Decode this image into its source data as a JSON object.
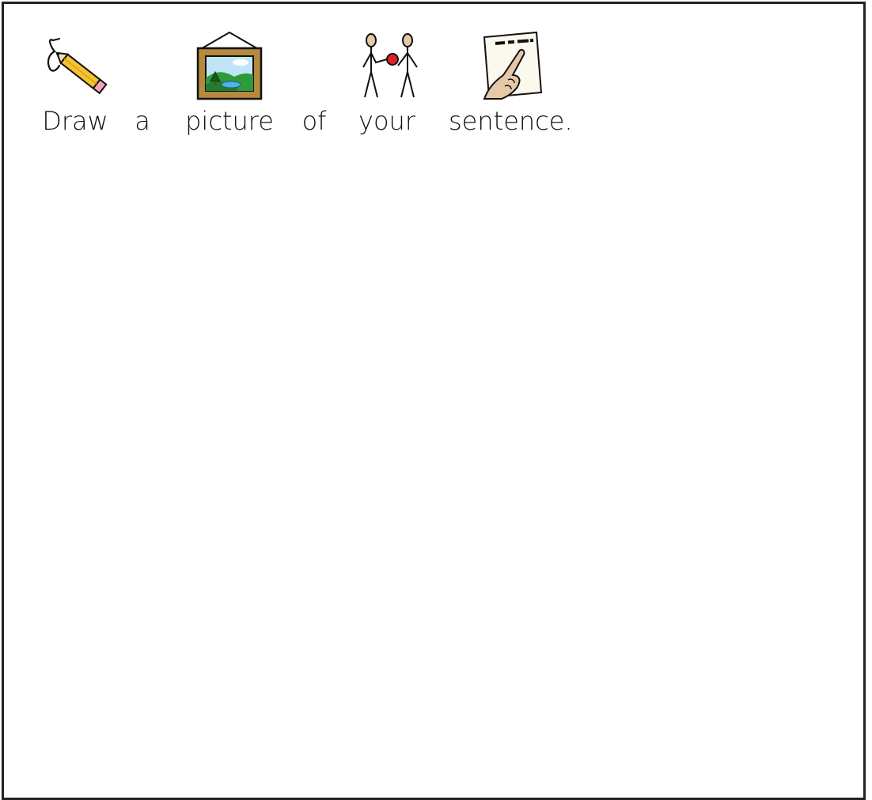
{
  "worksheet": {
    "instruction_words": [
      {
        "text": "Draw",
        "symbol": "pencil-writing-icon"
      },
      {
        "text": "a",
        "symbol": ""
      },
      {
        "text": "picture",
        "symbol": "framed-picture-icon"
      },
      {
        "text": "of",
        "symbol": ""
      },
      {
        "text": "your",
        "symbol": "two-people-your-icon"
      },
      {
        "text": "sentence.",
        "symbol": "pointing-at-text-icon"
      }
    ]
  },
  "colors": {
    "border": "#222222",
    "pencil": "#f2c230",
    "frame": "#b58a3c",
    "grass": "#2e9b3a",
    "sky": "#bfe6f6",
    "ball": "#e0202a",
    "skin": "#e6c9a8"
  }
}
